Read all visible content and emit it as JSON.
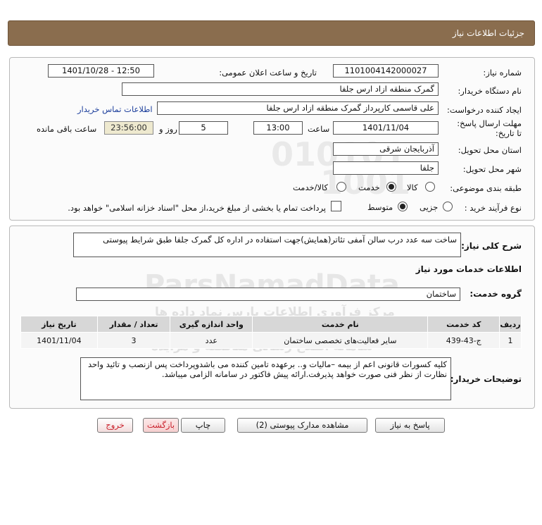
{
  "header": {
    "title": "جزئیات اطلاعات نیاز"
  },
  "form": {
    "need_number_label": "شماره نیاز:",
    "need_number": "1101004142000027",
    "announce_label": "تاریخ و ساعت اعلان عمومی:",
    "announce_value": "1401/10/28 - 12:50",
    "buyer_org_label": "نام دستگاه خریدار:",
    "buyer_org": "گمرک منطقه ازاد ارس جلفا",
    "requester_label": "ایجاد کننده درخواست:",
    "requester": "علی  قاسمی کارپرداز گمرک منطقه ازاد ارس جلفا",
    "contact_link": "اطلاعات تماس خریدار",
    "deadline_label": "مهلت ارسال پاسخ: تا تاریخ:",
    "deadline_date": "1401/11/04",
    "time_label": "ساعت",
    "deadline_time": "13:00",
    "days_value": "5",
    "days_label": "روز و",
    "remaining_time": "23:56:00",
    "remaining_label": "ساعت باقی مانده",
    "province_label": "استان محل تحویل:",
    "province": "آذربایجان شرقی",
    "city_label": "شهر محل تحویل:",
    "city": "جلفا",
    "category_label": "طبقه بندی موضوعی:",
    "category_options": [
      "کالا",
      "خدمت",
      "کالا/خدمت"
    ],
    "category_selected": "خدمت",
    "process_label": "نوع فرآیند خرید :",
    "process_options": [
      "جزیی",
      "متوسط"
    ],
    "process_selected": "متوسط",
    "payment_note": "پرداخت تمام یا بخشی از مبلغ خرید،از محل \"اسناد خزانه اسلامی\" خواهد بود."
  },
  "summary": {
    "label": "شرح کلی نیاز:",
    "text": "ساخت سه عدد درب سالن آمفی تئاتر(همایش)جهت استفاده در اداره کل گمرک جلفا طبق شرایط پیوستی"
  },
  "services": {
    "section_title": "اطلاعات خدمات مورد نیاز",
    "group_label": "گروه خدمت:",
    "group_value": "ساختمان",
    "table": {
      "headers": [
        "ردیف",
        "کد خدمت",
        "نام خدمت",
        "واحد اندازه گیری",
        "تعداد / مقدار",
        "تاریخ نیاز"
      ],
      "rows": [
        [
          "1",
          "ج-43-439",
          "سایر فعالیت‌های تخصصی ساختمان",
          "عدد",
          "3",
          "1401/11/04"
        ]
      ]
    }
  },
  "buyer_notes": {
    "label": "توضیحات خریدار:",
    "text": "کلیه کسورات قانونی اعم از بیمه –مالیات و.. برعهده تامین کننده می باشدوپرداخت پس ازنصب و تائید واحد نظارت از نظر فنی صورت خواهد پذیرفت.ارائه پیش فاکتور در سامانه الزامی میباشد."
  },
  "buttons": {
    "reply": "پاسخ به نیاز",
    "docs": "مشاهده مدارک پیوستی (2)",
    "print": "چاپ",
    "back": "بازگشت",
    "exit": "خروج"
  },
  "watermark": {
    "brand": "ParsNamadData",
    "line1": "مرکز فرآوری اطلاعات پارس نماد داده ها",
    "line2": "سامانه اطلاع رسانی مناقصه و مزایده",
    "digits1": "010101",
    "digits2": "1001"
  },
  "colors": {
    "header_bg": "#8a6d4e",
    "table_header_bg": "#d7d7d7",
    "timer_bg": "#eee9cf",
    "link": "#1d3f9c"
  }
}
